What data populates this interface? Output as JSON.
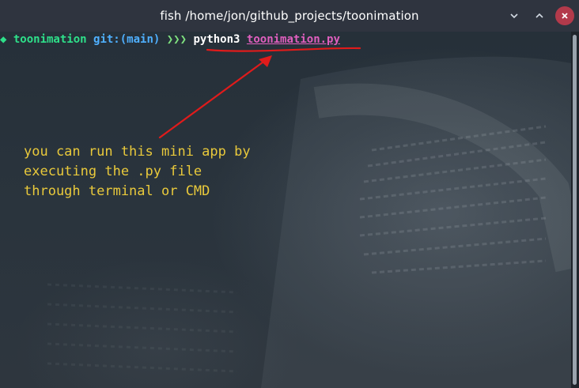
{
  "window": {
    "title": "fish /home/jon/github_projects/toonimation"
  },
  "prompt": {
    "marker": "◆ ",
    "directory": "toonimation ",
    "git_label": "git:(",
    "branch": "main",
    "git_close": ") ",
    "arrows": "❯❯❯ ",
    "command": "python3 ",
    "file": "toonimation.py"
  },
  "annotation": {
    "line1": "you can run this mini app by",
    "line2": "executing the .py file",
    "line3": "through terminal or CMD",
    "color": "#e9c93b",
    "arrow_color": "#e01b1b"
  },
  "colors": {
    "titlebar_bg": "#2f343f",
    "close_button": "#b33a4b",
    "prompt_green": "#2ee08a",
    "git_blue": "#4fb0ff",
    "file_pink": "#e05fbf"
  },
  "icons": {
    "minimize": "minimize-icon",
    "maximize": "maximize-icon",
    "close": "close-icon"
  }
}
